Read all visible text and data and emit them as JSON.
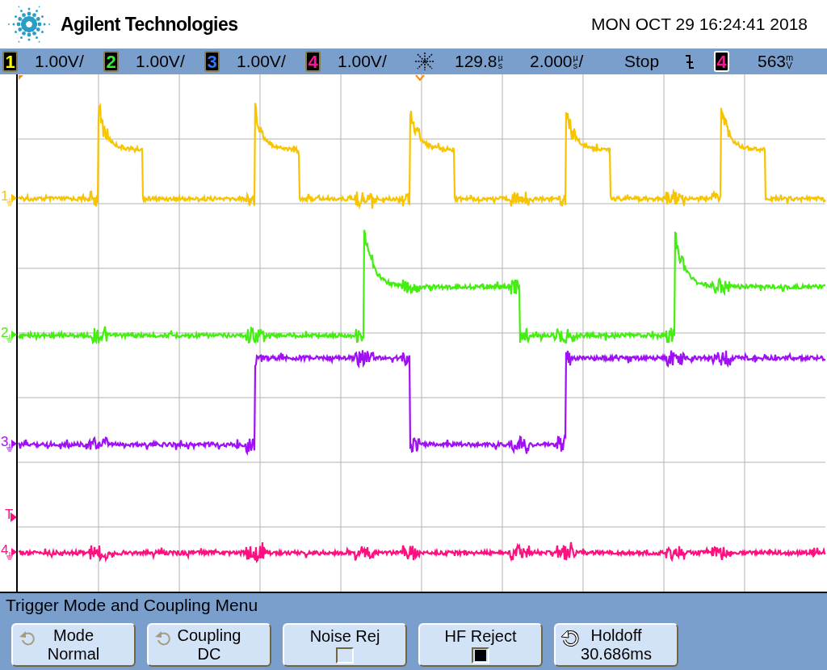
{
  "header": {
    "brand": "Agilent Technologies",
    "datetime": "MON OCT 29 16:24:41 2018"
  },
  "status_bar": {
    "channels": [
      {
        "number": "1",
        "scale": "1.00V/"
      },
      {
        "number": "2",
        "scale": "1.00V/"
      },
      {
        "number": "3",
        "scale": "1.00V/"
      },
      {
        "number": "4",
        "scale": "1.00V/"
      }
    ],
    "delay": {
      "value": "129.8",
      "unit": "µs"
    },
    "timebase": {
      "value": "2.000",
      "unit": "µs",
      "suffix": "/"
    },
    "run_state": "Stop",
    "trigger_source": {
      "number": "4"
    },
    "trigger_level": {
      "value": "563",
      "unit": "mV"
    }
  },
  "traces": [
    {
      "label": "1",
      "color": "#f7c400"
    },
    {
      "label": "2",
      "color": "#44ee11"
    },
    {
      "label": "3",
      "color": "#a010f5"
    },
    {
      "label": "4",
      "color": "#ff0f80"
    }
  ],
  "trigger_marker": {
    "label": "T",
    "color": "#ff0f80"
  },
  "menu": {
    "title": "Trigger Mode and Coupling Menu",
    "softkeys": [
      {
        "kind": "rotary",
        "label": "Mode",
        "value": "Normal",
        "active": false
      },
      {
        "kind": "rotary",
        "label": "Coupling",
        "value": "DC",
        "active": false
      },
      {
        "kind": "checkbox",
        "label": "Noise Rej",
        "checked": false
      },
      {
        "kind": "checkbox",
        "label": "HF Reject",
        "checked": true
      },
      {
        "kind": "rotary",
        "label": "Holdoff",
        "value": "30.686ms",
        "active": true
      }
    ]
  }
}
